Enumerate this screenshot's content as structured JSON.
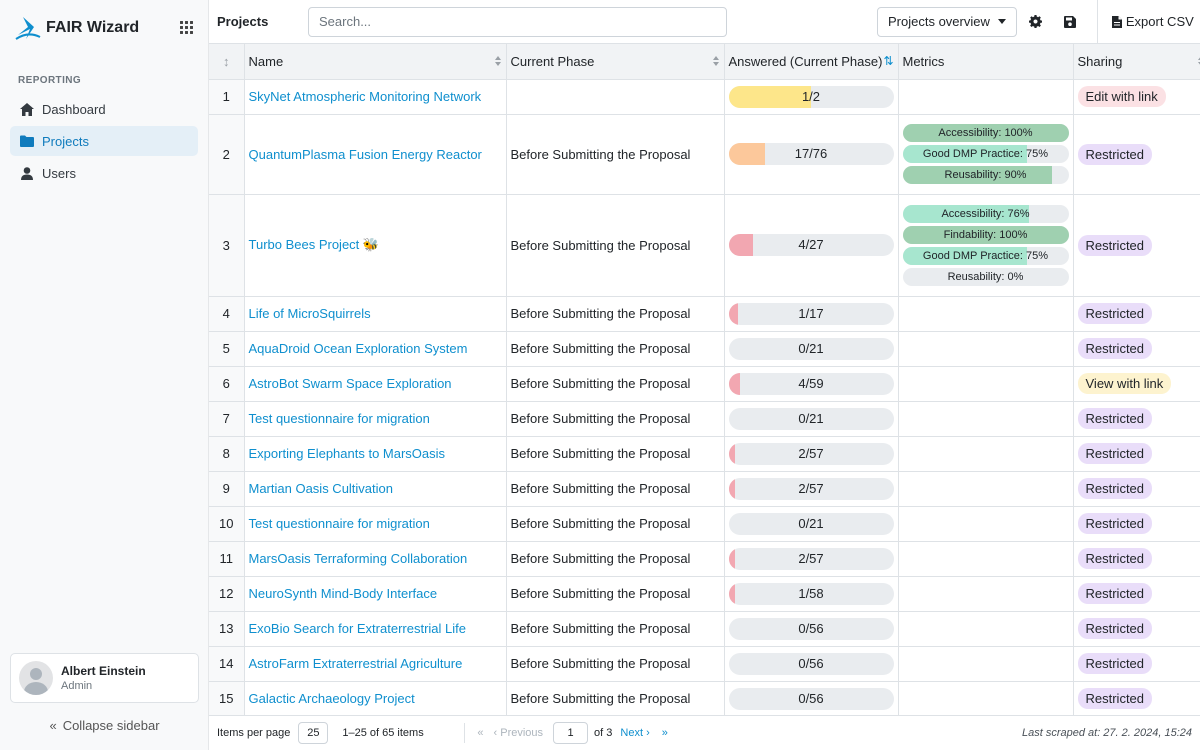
{
  "app": {
    "name": "FAIR Wizard"
  },
  "sidebar": {
    "section_title": "REPORTING",
    "items": [
      {
        "label": "Dashboard",
        "icon": "home-icon",
        "active": false
      },
      {
        "label": "Projects",
        "icon": "folder-icon",
        "active": true
      },
      {
        "label": "Users",
        "icon": "user-icon",
        "active": false
      }
    ],
    "profile": {
      "name": "Albert Einstein",
      "role": "Admin"
    },
    "collapse_label": "Collapse sidebar"
  },
  "header": {
    "title": "Projects",
    "search_placeholder": "Search...",
    "view_selected": "Projects overview",
    "export_label": "Export CSV"
  },
  "table": {
    "columns": [
      "Name",
      "Current Phase",
      "Answered (Current Phase)",
      "Metrics",
      "Sharing"
    ],
    "rows": [
      {
        "num": "1",
        "name": "SkyNet Atmospheric Monitoring Network",
        "phase": "",
        "answered": "1/2",
        "ratio": 0.5,
        "color": "#fde68a",
        "metrics": [],
        "sharing": "Edit with link",
        "sharing_style": "pink"
      },
      {
        "num": "2",
        "name": "QuantumPlasma Fusion Energy Reactor",
        "phase": "Before Submitting the Proposal",
        "answered": "17/76",
        "ratio": 0.224,
        "color": "#fcc89b",
        "metrics": [
          {
            "label": "Accessibility: 100%",
            "ratio": 1.0,
            "color": "#9fd0b0"
          },
          {
            "label": "Good DMP Practice: 75%",
            "ratio": 0.75,
            "color": "#a7e6cf"
          },
          {
            "label": "Reusability: 90%",
            "ratio": 0.9,
            "color": "#9fd0b0"
          }
        ],
        "sharing": "Restricted",
        "sharing_style": "purple"
      },
      {
        "num": "3",
        "name": "Turbo Bees Project 🐝",
        "phase": "Before Submitting the Proposal",
        "answered": "4/27",
        "ratio": 0.148,
        "color": "#f2a7b1",
        "metrics": [
          {
            "label": "Accessibility: 76%",
            "ratio": 0.76,
            "color": "#a7e6cf"
          },
          {
            "label": "Findability: 100%",
            "ratio": 1.0,
            "color": "#9fd0b0"
          },
          {
            "label": "Good DMP Practice: 75%",
            "ratio": 0.75,
            "color": "#a7e6cf"
          },
          {
            "label": "Reusability: 0%",
            "ratio": 0.0,
            "color": "#a7e6cf"
          }
        ],
        "sharing": "Restricted",
        "sharing_style": "purple"
      },
      {
        "num": "4",
        "name": "Life of MicroSquirrels",
        "phase": "Before Submitting the Proposal",
        "answered": "1/17",
        "ratio": 0.059,
        "color": "#f2a7b1",
        "metrics": [],
        "sharing": "Restricted",
        "sharing_style": "purple"
      },
      {
        "num": "5",
        "name": "AquaDroid Ocean Exploration System",
        "phase": "Before Submitting the Proposal",
        "answered": "0/21",
        "ratio": 0,
        "color": "#f2a7b1",
        "metrics": [],
        "sharing": "Restricted",
        "sharing_style": "purple"
      },
      {
        "num": "6",
        "name": "AstroBot Swarm Space Exploration",
        "phase": "Before Submitting the Proposal",
        "answered": "4/59",
        "ratio": 0.068,
        "color": "#f2a7b1",
        "metrics": [],
        "sharing": "View with link",
        "sharing_style": "yellow"
      },
      {
        "num": "7",
        "name": "Test questionnaire for migration",
        "phase": "Before Submitting the Proposal",
        "answered": "0/21",
        "ratio": 0,
        "color": "#f2a7b1",
        "metrics": [],
        "sharing": "Restricted",
        "sharing_style": "purple"
      },
      {
        "num": "8",
        "name": "Exporting Elephants to MarsOasis",
        "phase": "Before Submitting the Proposal",
        "answered": "2/57",
        "ratio": 0.035,
        "color": "#f2a7b1",
        "metrics": [],
        "sharing": "Restricted",
        "sharing_style": "purple"
      },
      {
        "num": "9",
        "name": "Martian Oasis Cultivation",
        "phase": "Before Submitting the Proposal",
        "answered": "2/57",
        "ratio": 0.035,
        "color": "#f2a7b1",
        "metrics": [],
        "sharing": "Restricted",
        "sharing_style": "purple"
      },
      {
        "num": "10",
        "name": "Test questionnaire for migration",
        "phase": "Before Submitting the Proposal",
        "answered": "0/21",
        "ratio": 0,
        "color": "#f2a7b1",
        "metrics": [],
        "sharing": "Restricted",
        "sharing_style": "purple"
      },
      {
        "num": "11",
        "name": "MarsOasis Terraforming Collaboration",
        "phase": "Before Submitting the Proposal",
        "answered": "2/57",
        "ratio": 0.035,
        "color": "#f2a7b1",
        "metrics": [],
        "sharing": "Restricted",
        "sharing_style": "purple"
      },
      {
        "num": "12",
        "name": "NeuroSynth Mind-Body Interface",
        "phase": "Before Submitting the Proposal",
        "answered": "1/58",
        "ratio": 0.017,
        "color": "#f2a7b1",
        "metrics": [],
        "sharing": "Restricted",
        "sharing_style": "purple"
      },
      {
        "num": "13",
        "name": "ExoBio Search for Extraterrestrial Life",
        "phase": "Before Submitting the Proposal",
        "answered": "0/56",
        "ratio": 0,
        "color": "#f2a7b1",
        "metrics": [],
        "sharing": "Restricted",
        "sharing_style": "purple"
      },
      {
        "num": "14",
        "name": "AstroFarm Extraterrestrial Agriculture",
        "phase": "Before Submitting the Proposal",
        "answered": "0/56",
        "ratio": 0,
        "color": "#f2a7b1",
        "metrics": [],
        "sharing": "Restricted",
        "sharing_style": "purple"
      },
      {
        "num": "15",
        "name": "Galactic Archaeology Project",
        "phase": "Before Submitting the Proposal",
        "answered": "0/56",
        "ratio": 0,
        "color": "#f2a7b1",
        "metrics": [],
        "sharing": "Restricted",
        "sharing_style": "purple"
      }
    ]
  },
  "footer": {
    "items_per_page_label": "Items per page",
    "items_per_page_value": "25",
    "range_text": "1–25 of 65 items",
    "previous_label": "Previous",
    "page_value": "1",
    "of_pages": "of 3",
    "next_label": "Next",
    "last_scraped": "Last scraped at: 27. 2. 2024, 15:24"
  },
  "colors": {
    "accent": "#0f8fce",
    "badge_purple_bg": "#e9ddf9",
    "badge_pink_bg": "#fbe1e4",
    "badge_yellow_bg": "#fdf3cf"
  }
}
